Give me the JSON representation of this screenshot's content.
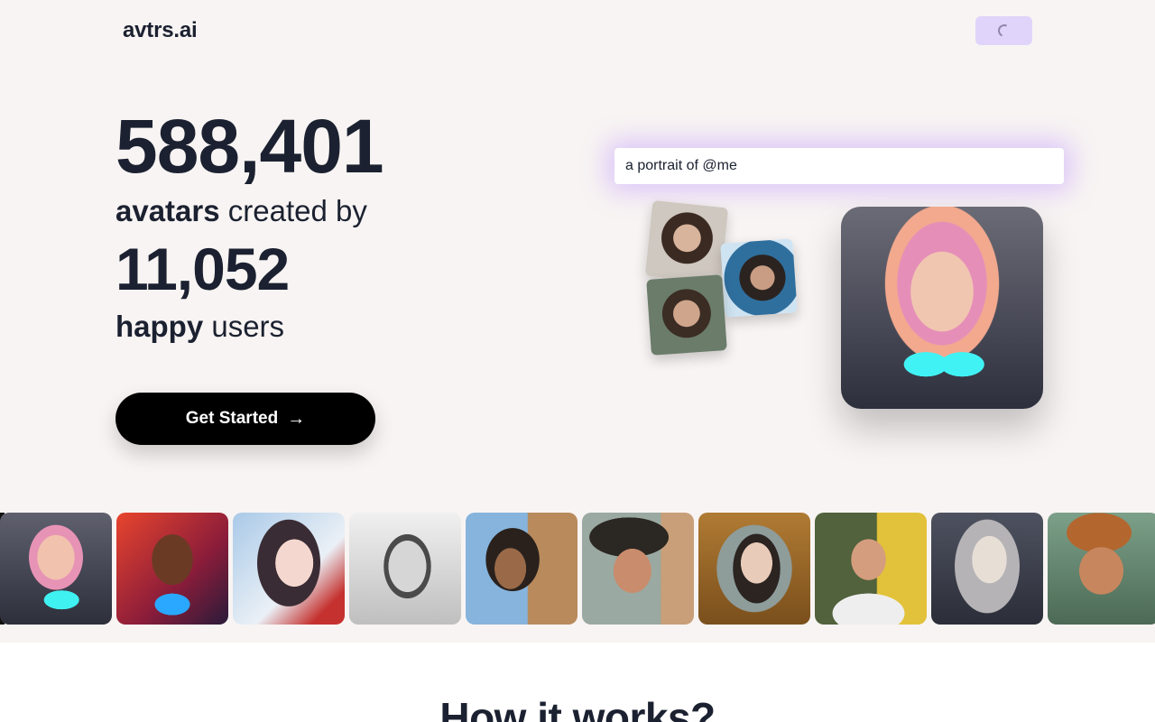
{
  "header": {
    "logo": "avtrs.ai",
    "nav_button_state": "loading",
    "nav_button_color": "#e0d4fb"
  },
  "hero": {
    "avatars_count": "588,401",
    "line1_bold": "avatars",
    "line1_rest": " created by",
    "users_count": "11,052",
    "line2_bold": "happy",
    "line2_rest": " users",
    "cta_label": "Get Started",
    "cta_icon": "arrow-right-icon"
  },
  "demo": {
    "prompt_text": "a portrait of @me",
    "prompt_glow_color": "#b98cff"
  },
  "how_section": {
    "title": "How it works?"
  }
}
